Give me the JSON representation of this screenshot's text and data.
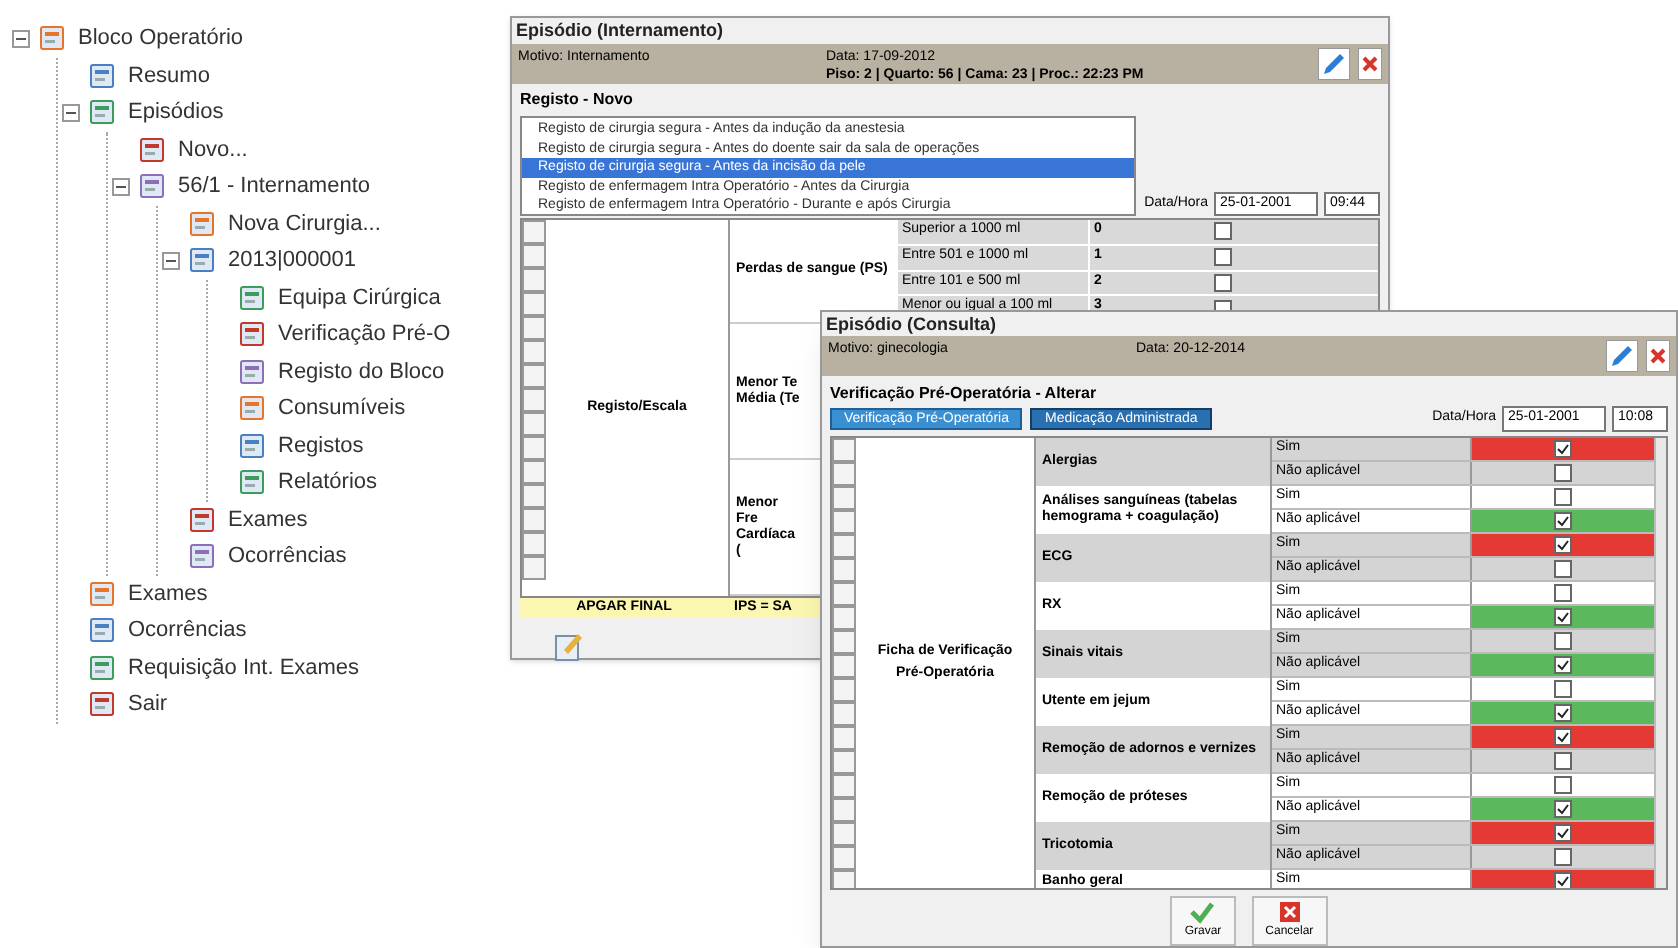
{
  "tree": [
    {
      "label": "Bloco Operatório",
      "expanded": true,
      "children": [
        {
          "label": "Resumo"
        },
        {
          "label": "Episódios",
          "expanded": true,
          "children": [
            {
              "label": "Novo..."
            },
            {
              "label": "56/1 - Internamento",
              "expanded": true,
              "children": [
                {
                  "label": "Nova Cirurgia..."
                },
                {
                  "label": "2013|000001",
                  "expanded": true,
                  "children": [
                    {
                      "label": "Equipa Cirúrgica"
                    },
                    {
                      "label": "Verificação Pré-O"
                    },
                    {
                      "label": "Registo do Bloco"
                    },
                    {
                      "label": "Consumíveis"
                    },
                    {
                      "label": "Registos"
                    },
                    {
                      "label": "Relatórios"
                    }
                  ]
                },
                {
                  "label": "Exames"
                },
                {
                  "label": "Ocorrências"
                }
              ]
            }
          ]
        },
        {
          "label": "Exames"
        },
        {
          "label": "Ocorrências"
        },
        {
          "label": "Requisição Int. Exames"
        },
        {
          "label": "Sair"
        }
      ]
    }
  ],
  "back_window": {
    "title": "Episódio (Internamento)",
    "motivo": "Motivo: Internamento",
    "date": "Data: 17-09-2012",
    "location": "Piso: 2 | Quarto: 56 | Cama: 23 | Proc.: 22:23 PM",
    "section": "Registo - Novo",
    "records": [
      {
        "label": "Registo de cirurgia segura - Antes da indução da anestesia",
        "selected": false
      },
      {
        "label": "Registo de cirurgia segura - Antes do doente sair da sala de operações",
        "selected": false
      },
      {
        "label": "Registo de cirurgia segura - Antes da incisão da pele",
        "selected": true
      },
      {
        "label": "Registo de enfermagem Intra Operatório - Antes da Cirurgia",
        "selected": false
      },
      {
        "label": "Registo de enfermagem Intra Operatório - Durante e após Cirurgia",
        "selected": false
      }
    ],
    "datetime_label": "Data/Hora",
    "date_value": "25-01-2001",
    "time_value": "09:44",
    "group": "Registo/Escala",
    "item": "Perdas de sangue (PS)",
    "options": [
      {
        "label": "Superior a 1000 ml",
        "score": "0",
        "checked": false
      },
      {
        "label": "Entre 501 e 1000 ml",
        "score": "1",
        "checked": false
      },
      {
        "label": "Entre 101 e 500 ml",
        "score": "2",
        "checked": false
      },
      {
        "label": "Menor ou igual a 100 ml",
        "score": "3",
        "checked": false
      }
    ],
    "items_cut": [
      "Menor Te Média (Te",
      "Menor Fre Cardíaca ("
    ],
    "footer": [
      "APGAR FINAL",
      "IPS = SA"
    ]
  },
  "front_window": {
    "title": "Episódio (Consulta)",
    "motivo": "Motivo: ginecologia",
    "date": "Data: 20-12-2014",
    "section": "Verificação Pré-Operatória - Alterar",
    "tabs": [
      {
        "label": "Verificação Pré-Operatória",
        "selected": true
      },
      {
        "label": "Medicação Administrada",
        "selected": false
      }
    ],
    "datetime_label": "Data/Hora",
    "date_value": "25-01-2001",
    "time_value": "10:08",
    "group": "Ficha de Verificação Pré-Operatória",
    "items": [
      {
        "label": "Alergias",
        "options": [
          {
            "label": "Sim",
            "checked": true,
            "color": "#e53935"
          },
          {
            "label": "Não aplicável",
            "checked": false
          }
        ]
      },
      {
        "label": "Análises sanguíneas (tabelas hemograma + coagulação)",
        "options": [
          {
            "label": "Sim",
            "checked": false
          },
          {
            "label": "Não aplicável",
            "checked": true,
            "color": "#5cb85c"
          }
        ]
      },
      {
        "label": "ECG",
        "options": [
          {
            "label": "Sim",
            "checked": true,
            "color": "#e53935"
          },
          {
            "label": "Não aplicável",
            "checked": false
          }
        ]
      },
      {
        "label": "RX",
        "options": [
          {
            "label": "Sim",
            "checked": false
          },
          {
            "label": "Não aplicável",
            "checked": true,
            "color": "#5cb85c"
          }
        ]
      },
      {
        "label": "Sinais vitais",
        "options": [
          {
            "label": "Sim",
            "checked": false
          },
          {
            "label": "Não aplicável",
            "checked": true,
            "color": "#5cb85c"
          }
        ]
      },
      {
        "label": "Utente em jejum",
        "options": [
          {
            "label": "Sim",
            "checked": false
          },
          {
            "label": "Não aplicável",
            "checked": true,
            "color": "#5cb85c"
          }
        ]
      },
      {
        "label": "Remoção de adornos e vernizes",
        "options": [
          {
            "label": "Sim",
            "checked": true,
            "color": "#e53935"
          },
          {
            "label": "Não aplicável",
            "checked": false
          }
        ]
      },
      {
        "label": "Remoção de próteses",
        "options": [
          {
            "label": "Sim",
            "checked": false
          },
          {
            "label": "Não aplicável",
            "checked": true,
            "color": "#5cb85c"
          }
        ]
      },
      {
        "label": "Tricotomia",
        "options": [
          {
            "label": "Sim",
            "checked": true,
            "color": "#e53935"
          },
          {
            "label": "Não aplicável",
            "checked": false
          }
        ]
      },
      {
        "label": "Banho geral",
        "options": [
          {
            "label": "Sim",
            "checked": true,
            "color": "#e53935"
          }
        ]
      }
    ],
    "buttons": [
      "Gravar",
      "Cancelar"
    ]
  }
}
